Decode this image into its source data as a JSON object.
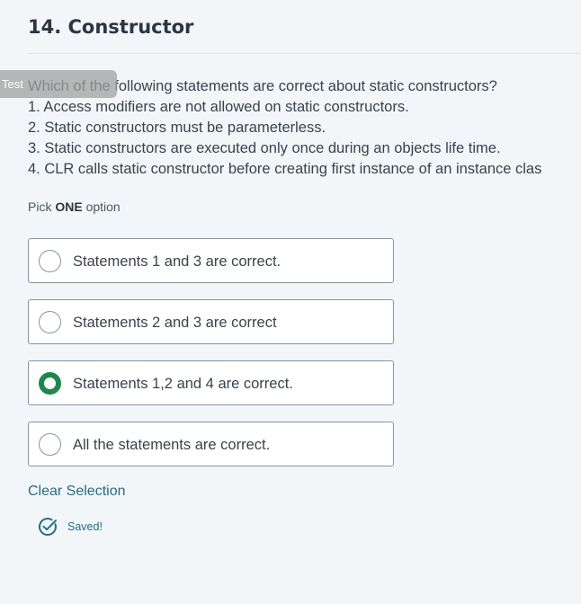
{
  "question": {
    "title": "14. Constructor",
    "badge": "Test",
    "lines": [
      "Which of the following statements are correct about static constructors?",
      "1. Access modifiers are not allowed on static constructors.",
      "2. Static constructors must be parameterless.",
      "3. Static constructors are executed only once during an objects life time.",
      "4. CLR calls static constructor before creating first instance of an instance clas"
    ]
  },
  "instructions": {
    "pick_prefix": "Pick ",
    "pick_emphasis": "ONE",
    "pick_suffix": " option"
  },
  "options": [
    {
      "label": "Statements 1 and 3 are correct.",
      "selected": false
    },
    {
      "label": "Statements 2 and 3 are correct",
      "selected": false
    },
    {
      "label": "Statements 1,2 and 4 are correct.",
      "selected": true
    },
    {
      "label": "All the statements are correct.",
      "selected": false
    }
  ],
  "actions": {
    "clear_selection": "Clear Selection"
  },
  "status": {
    "saved_text": "Saved!",
    "icon": "check-circle-icon"
  },
  "colors": {
    "selected_radio": "#1a8a4a",
    "link": "#1f6f8b"
  }
}
